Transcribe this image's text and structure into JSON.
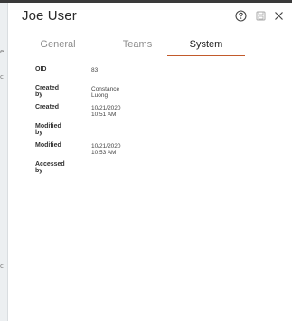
{
  "window": {
    "title": "Joe User"
  },
  "header_icons": {
    "help": "help-circle-icon",
    "save": "save-icon",
    "close": "close-icon"
  },
  "tabs": [
    {
      "label": "General",
      "active": false
    },
    {
      "label": "Teams",
      "active": false
    },
    {
      "label": "System",
      "active": true
    }
  ],
  "accent_color": "#c25a2b",
  "fields": [
    {
      "label": "OID",
      "value": "83"
    },
    {
      "label": "Created by",
      "value": "Constance Luong"
    },
    {
      "label": "Created",
      "value": "10/21/2020 10:51 AM"
    },
    {
      "label": "Modified by",
      "value": ""
    },
    {
      "label": "Modified",
      "value": "10/21/2020 10:53 AM"
    },
    {
      "label": "Accessed by",
      "value": ""
    }
  ],
  "backdrop": {
    "glyphs": [
      "e",
      "c",
      "c"
    ]
  }
}
